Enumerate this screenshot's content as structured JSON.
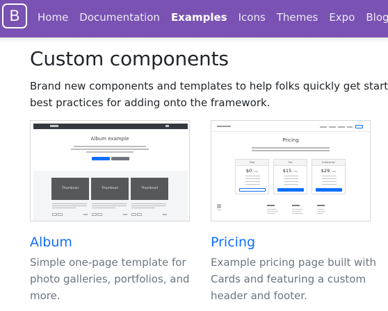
{
  "navbar": {
    "brand": "B",
    "links": [
      {
        "label": "Home",
        "active": false
      },
      {
        "label": "Documentation",
        "active": false
      },
      {
        "label": "Examples",
        "active": true
      },
      {
        "label": "Icons",
        "active": false
      },
      {
        "label": "Themes",
        "active": false
      },
      {
        "label": "Expo",
        "active": false
      },
      {
        "label": "Blog",
        "active": false
      }
    ]
  },
  "section": {
    "title": "Custom components",
    "lead_line1": "Brand new components and templates to help folks quickly get started w",
    "lead_line2": "best practices for adding onto the framework."
  },
  "cards": [
    {
      "title": "Album",
      "desc_line1": "Simple one-page template for",
      "desc_line2": "photo galleries, portfolios, and",
      "desc_line3": "more.",
      "thumb": {
        "heading": "Album example",
        "tiles": [
          "Thumbnail",
          "Thumbnail",
          "Thumbnail"
        ]
      }
    },
    {
      "title": "Pricing",
      "desc_line1": "Example pricing page built with",
      "desc_line2": "Cards and featuring a custom",
      "desc_line3": "header and footer.",
      "thumb": {
        "heading": "Pricing",
        "plans": [
          {
            "name": "Free",
            "price": "$0",
            "period": " / mo"
          },
          {
            "name": "Pro",
            "price": "$15",
            "period": " / mo"
          },
          {
            "name": "Enterprise",
            "price": "$29",
            "period": " / mo"
          }
        ]
      }
    }
  ],
  "colors": {
    "navbar": "#7952b3",
    "link": "#0d6efd",
    "muted": "#6c757d"
  }
}
